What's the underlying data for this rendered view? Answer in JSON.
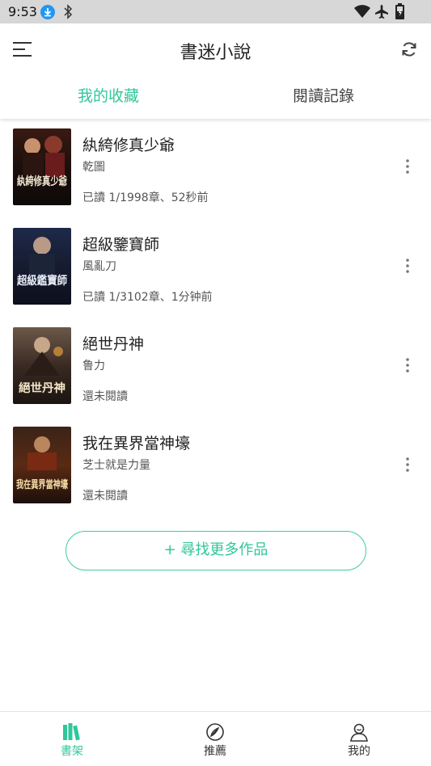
{
  "status_bar": {
    "time": "9:53"
  },
  "header": {
    "title": "書迷小說"
  },
  "tabs": [
    {
      "label": "我的收藏",
      "active": true
    },
    {
      "label": "閱讀記錄",
      "active": false
    }
  ],
  "books": [
    {
      "title": "紈絝修真少爺",
      "author": "乾圖",
      "progress": "已讀 1/1998章、52秒前",
      "cover_text": "紈絝修真少爺"
    },
    {
      "title": "超級鑒寶師",
      "author": "風亂刀",
      "progress": "已讀 1/3102章、1分钟前",
      "cover_text": "超級鑑寶師"
    },
    {
      "title": "絕世丹神",
      "author": "鲁力",
      "progress": "還未閱讀",
      "cover_text": "絕世丹神"
    },
    {
      "title": "我在異界當神壕",
      "author": "芝士就是力量",
      "progress": "還未閱讀",
      "cover_text": "我在異界當神壕"
    }
  ],
  "find_more_label": "+ 尋找更多作品",
  "bottom_nav": [
    {
      "label": "書架",
      "icon": "bookshelf-icon",
      "active": true
    },
    {
      "label": "推薦",
      "icon": "recommend-icon",
      "active": false
    },
    {
      "label": "我的",
      "icon": "profile-icon",
      "active": false
    }
  ],
  "colors": {
    "accent": "#2fc79a",
    "status_bar": "#d7d7d7",
    "text": "#222222",
    "secondary_text": "#555555"
  }
}
